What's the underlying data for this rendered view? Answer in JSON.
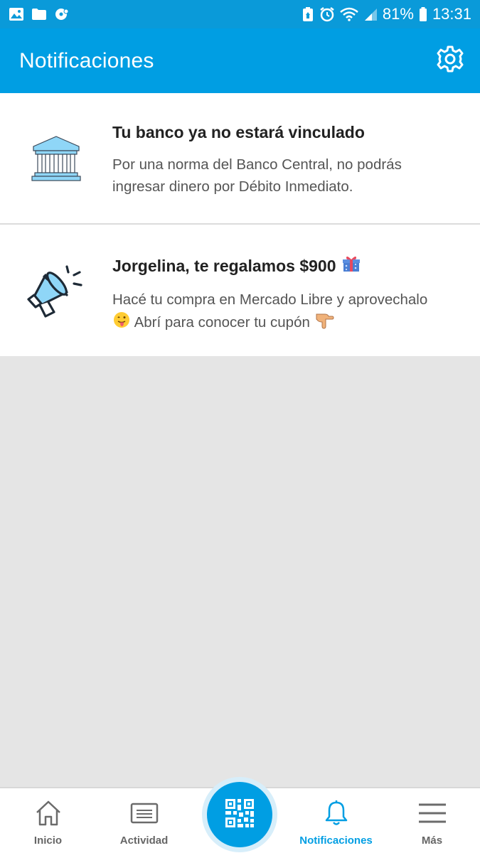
{
  "status_bar": {
    "battery_percent": "81%",
    "time": "13:31"
  },
  "header": {
    "title": "Notificaciones"
  },
  "notifications": [
    {
      "icon": "bank-icon",
      "title": "Tu banco ya no estará vinculado",
      "text_line1": "Por una norma del Banco Central, no podrás",
      "text_line2": "ingresar dinero por Débito Inmediato."
    },
    {
      "icon": "megaphone-icon",
      "title": "Jorgelina, te regalamos $900",
      "title_emoji": "gift-icon",
      "text_line1": "Hacé tu compra en Mercado Libre y aprovechalo",
      "text_line2": "Abrí para conocer tu cupón",
      "text_emoji_1": "tongue-face-emoji",
      "text_emoji_2": "pointing-down-hand-emoji"
    }
  ],
  "bottom_nav": {
    "items": [
      {
        "label": "Inicio",
        "icon": "home-icon"
      },
      {
        "label": "Actividad",
        "icon": "activity-icon"
      },
      {
        "label": "",
        "icon": "qr-code-icon"
      },
      {
        "label": "Notificaciones",
        "icon": "bell-icon",
        "active": true
      },
      {
        "label": "Más",
        "icon": "menu-icon"
      }
    ]
  },
  "colors": {
    "primary": "#009ee3",
    "status_bar": "#0a9ad9",
    "background": "#e5e5e5",
    "title_text": "#222222",
    "body_text": "#555555",
    "icon_fill": "#8fd6f7"
  }
}
